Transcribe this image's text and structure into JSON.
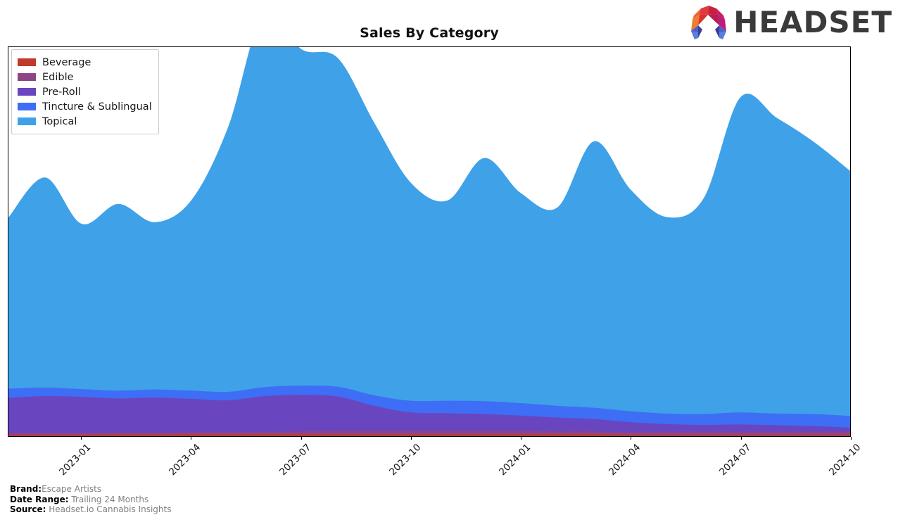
{
  "header": {
    "title": "Sales By Category",
    "brand_name": "HEADSET",
    "logo_icon": "headset-logo-icon"
  },
  "legend": {
    "position": "upper-left",
    "items": [
      {
        "label": "Beverage",
        "color": "#c0392b"
      },
      {
        "label": "Edible",
        "color": "#8e4585"
      },
      {
        "label": "Pre-Roll",
        "color": "#6a45c0"
      },
      {
        "label": "Tincture & Sublingual",
        "color": "#3d6ef5"
      },
      {
        "label": "Topical",
        "color": "#3fa1e8"
      }
    ]
  },
  "footer": {
    "rows": [
      {
        "key": "Brand:",
        "value": "Escape Artists",
        "space": false
      },
      {
        "key": "Date Range:",
        "value": "Trailing 24 Months",
        "space": true
      },
      {
        "key": "Source:",
        "value": "Headset.io Cannabis Insights",
        "space": true
      }
    ]
  },
  "chart_data": {
    "type": "area",
    "stacked": true,
    "title": "Sales By Category",
    "xlabel": "",
    "ylabel": "",
    "grid": false,
    "legend_position": "upper-left",
    "x": [
      "2022-11",
      "2022-12",
      "2023-01",
      "2023-02",
      "2023-03",
      "2023-04",
      "2023-05",
      "2023-06",
      "2023-07",
      "2023-08",
      "2023-09",
      "2023-10",
      "2023-11",
      "2023-12",
      "2024-01",
      "2024-02",
      "2024-03",
      "2024-04",
      "2024-05",
      "2024-06",
      "2024-07",
      "2024-08",
      "2024-09",
      "2024-10"
    ],
    "xtick_labels": [
      "2023-01",
      "2023-04",
      "2023-07",
      "2023-10",
      "2024-01",
      "2024-04",
      "2024-07",
      "2024-10"
    ],
    "xtick_positions": [
      2,
      5,
      8,
      11,
      14,
      17,
      20,
      23
    ],
    "ylim": [
      0,
      100
    ],
    "series": [
      {
        "name": "Beverage",
        "color": "#c0392b",
        "values": [
          0.3,
          0.3,
          0.3,
          0.4,
          0.4,
          0.4,
          0.4,
          0.4,
          0.4,
          0.4,
          0.4,
          0.4,
          0.4,
          0.4,
          0.4,
          0.4,
          0.4,
          0.3,
          0.3,
          0.3,
          0.3,
          0.3,
          0.3,
          0.3
        ]
      },
      {
        "name": "Edible",
        "color": "#8e4585",
        "values": [
          0.5,
          0.5,
          0.5,
          0.5,
          0.5,
          0.6,
          0.6,
          0.7,
          0.8,
          0.9,
          0.9,
          0.9,
          0.9,
          0.9,
          0.9,
          0.8,
          0.8,
          0.7,
          0.7,
          0.7,
          0.7,
          0.7,
          0.7,
          0.7
        ]
      },
      {
        "name": "Pre-Roll",
        "color": "#6a45c0",
        "values": [
          9.0,
          9.5,
          9.3,
          8.8,
          9.0,
          8.6,
          8.2,
          9.2,
          9.4,
          8.9,
          6.5,
          4.8,
          4.6,
          4.4,
          4.0,
          3.6,
          3.2,
          2.6,
          2.1,
          1.9,
          2.0,
          1.8,
          1.6,
          1.2
        ]
      },
      {
        "name": "Tincture & Sublingual",
        "color": "#3d6ef5",
        "values": [
          2.4,
          2.2,
          2.0,
          2.0,
          2.1,
          2.1,
          2.2,
          2.3,
          2.4,
          2.5,
          2.7,
          3.0,
          3.2,
          3.3,
          3.2,
          3.0,
          2.9,
          2.8,
          2.7,
          2.8,
          3.1,
          3.0,
          3.1,
          3.0
        ]
      },
      {
        "name": "Topical",
        "color": "#3fa1e8",
        "values": [
          44.0,
          54.0,
          42.5,
          48.0,
          43.0,
          49.0,
          68.0,
          97.0,
          86.5,
          84.5,
          70.0,
          56.0,
          51.5,
          62.5,
          54.0,
          51.0,
          68.5,
          57.0,
          50.5,
          55.5,
          81.0,
          76.0,
          70.0,
          63.0
        ]
      }
    ]
  }
}
